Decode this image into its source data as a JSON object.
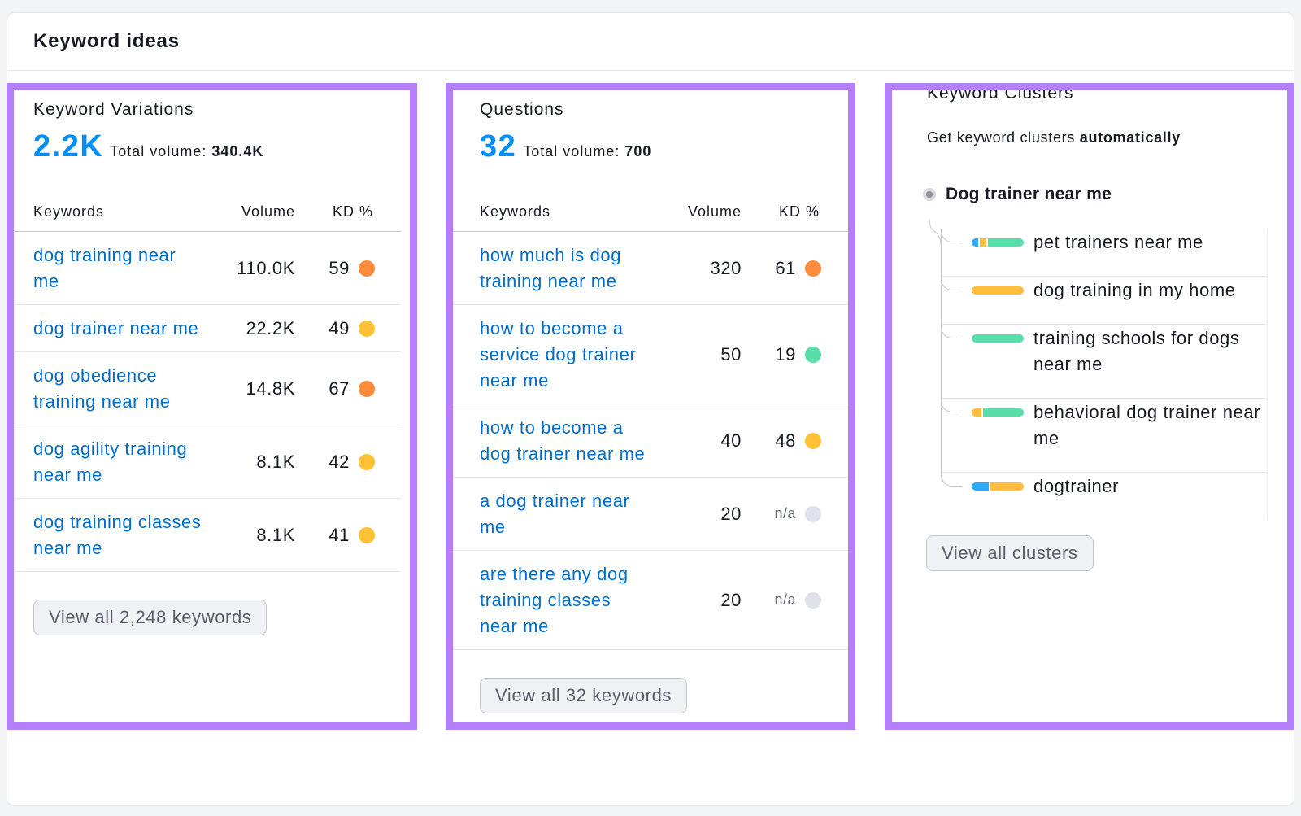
{
  "theme": {
    "accent": "#008ff8",
    "link": "#006dca",
    "highlight_border": "#b57ffc"
  },
  "widget": {
    "title": "Keyword ideas"
  },
  "variations": {
    "title": "Keyword Variations",
    "count": "2.2K",
    "total_volume_label": "Total volume:",
    "total_volume": "340.4K",
    "columns": {
      "keyword": "Keywords",
      "volume": "Volume",
      "kd": "KD %"
    },
    "rows": [
      {
        "keyword": "dog training near me",
        "volume": "110.0K",
        "kd": "59",
        "kd_color": "#ff8b3d"
      },
      {
        "keyword": "dog trainer near me",
        "volume": "22.2K",
        "kd": "49",
        "kd_color": "#ffc236"
      },
      {
        "keyword": "dog obedience training near me",
        "volume": "14.8K",
        "kd": "67",
        "kd_color": "#ff8b3d"
      },
      {
        "keyword": "dog agility training near me",
        "volume": "8.1K",
        "kd": "42",
        "kd_color": "#ffc236"
      },
      {
        "keyword": "dog training classes near me",
        "volume": "8.1K",
        "kd": "41",
        "kd_color": "#ffc236"
      }
    ],
    "button_label": "View all 2,248 keywords"
  },
  "questions": {
    "title": "Questions",
    "count": "32",
    "total_volume_label": "Total volume:",
    "total_volume": "700",
    "columns": {
      "keyword": "Keywords",
      "volume": "Volume",
      "kd": "KD %"
    },
    "rows": [
      {
        "keyword": "how much is dog training near me",
        "volume": "320",
        "kd": "61",
        "kd_color": "#ff8b3d"
      },
      {
        "keyword": "how to become a service dog trainer near me",
        "volume": "50",
        "kd": "19",
        "kd_color": "#59dea9"
      },
      {
        "keyword": "how to become a dog trainer near me",
        "volume": "40",
        "kd": "48",
        "kd_color": "#ffc236"
      },
      {
        "keyword": "a dog trainer near me",
        "volume": "20",
        "kd": "n/a",
        "kd_color": "#e0e1e9"
      },
      {
        "keyword": "are there any dog training classes near me",
        "volume": "20",
        "kd": "n/a",
        "kd_color": "#e0e1e9"
      }
    ],
    "button_label": "View all 32 keywords"
  },
  "clusters": {
    "title": "Keyword Clusters",
    "subtitle_prefix": "Get keyword clusters",
    "subtitle_emphasis": "automatically",
    "root": "Dog trainer near me",
    "items": [
      {
        "keyword": "pet trainers near me",
        "intent_segments": [
          {
            "color": "#2bacff",
            "share": 0.13
          },
          {
            "color": "#ffbe3d",
            "share": 0.13
          },
          {
            "color": "#59dea9",
            "share": 0.74
          }
        ]
      },
      {
        "keyword": "dog training in my home",
        "intent_segments": [
          {
            "color": "#ffbe3d",
            "share": 1.0
          }
        ]
      },
      {
        "keyword": "training schools for dogs near me",
        "intent_segments": [
          {
            "color": "#59dea9",
            "share": 1.0
          }
        ]
      },
      {
        "keyword": "behavioral dog trainer near me",
        "intent_segments": [
          {
            "color": "#ffbe3d",
            "share": 0.2
          },
          {
            "color": "#59dea9",
            "share": 0.8
          }
        ]
      },
      {
        "keyword": "dogtrainer",
        "intent_segments": [
          {
            "color": "#2bacff",
            "share": 0.34
          },
          {
            "color": "#ffbe3d",
            "share": 0.66
          }
        ]
      }
    ],
    "button_label": "View all clusters"
  }
}
